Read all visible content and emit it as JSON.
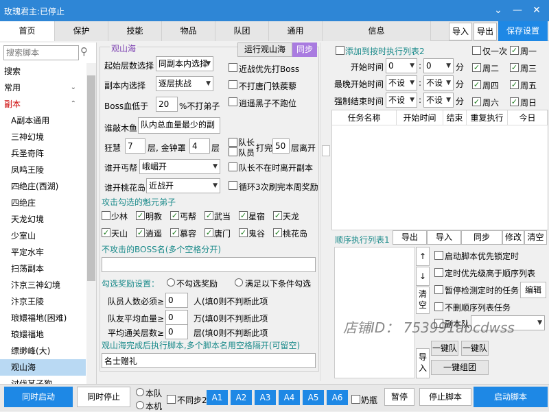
{
  "window": {
    "title": "玫瑰君主:已停止",
    "menu_icon": "chevron-down-icon",
    "min_icon": "minimize-icon",
    "close_icon": "close-icon"
  },
  "tabs": [
    "首页",
    "保护",
    "技能",
    "物品",
    "队团",
    "通用",
    "信息"
  ],
  "top_buttons": {
    "import": "导入",
    "export": "导出",
    "save": "保存设置"
  },
  "sidebar": {
    "search_placeholder": "搜索脚本",
    "items": [
      {
        "label": "搜索",
        "type": "cat"
      },
      {
        "label": "常用",
        "type": "cat",
        "chev": "⌄"
      },
      {
        "label": "副本",
        "type": "cat",
        "chev": "⌃",
        "red": true
      },
      {
        "label": "A副本通用"
      },
      {
        "label": "三神幻境"
      },
      {
        "label": "兵圣奇阵"
      },
      {
        "label": "凤鸣王陵"
      },
      {
        "label": "四绝庄(西湖)"
      },
      {
        "label": "四绝庄"
      },
      {
        "label": "天龙幻境"
      },
      {
        "label": "少室山"
      },
      {
        "label": "平定水牢"
      },
      {
        "label": "扫荡副本"
      },
      {
        "label": "汴京三神幻境"
      },
      {
        "label": "汴京王陵"
      },
      {
        "label": "琅嬛福地(困难)"
      },
      {
        "label": "琅嬛福地"
      },
      {
        "label": "缥缈峰(大)"
      },
      {
        "label": "观山海",
        "selected": true
      },
      {
        "label": "讨伐某子狗"
      }
    ]
  },
  "group": {
    "legend": "观山海",
    "run_button": "运行观山海",
    "sync_button": "同步"
  },
  "form": {
    "start_layer_label": "起始层数选择",
    "start_layer_value": "同副本内选择",
    "in_dungeon_label": "副本内选择",
    "in_dungeon_value": "逐层挑战",
    "boss_hp_label": "Boss血低于",
    "boss_hp_value": "20",
    "boss_hp_suffix": "%不打弟子",
    "who_fish_label": "谁敲木鱼",
    "who_fish_value": "队内总血量最少的副",
    "rage_label": "狂慧",
    "rage_value": "7",
    "rage_mid": "层, 金钟罩",
    "bell_value": "4",
    "bell_suffix": "层",
    "who_beggar_label": "谁开丐帮",
    "who_beggar_value": "峨嵋开",
    "who_peach_label": "谁开桃花岛",
    "who_peach_value": "近战开",
    "cb_melee": "近战优先打Boss",
    "cb_tangmen": "不打唐门铁蒺藜",
    "cb_escape": "逍遥黑子不跑位",
    "cb_leader": "队长",
    "cb_member": "队员",
    "fight_label": "打完",
    "fight_value": "50",
    "fight_suffix": "层离开",
    "cb_leader_leave": "队长不在时离开副本",
    "cb_loop": "循环3次刷完本周奖励",
    "attack_title": "攻击勾选的魁元弟子",
    "sects": [
      {
        "name": "少林",
        "on": false
      },
      {
        "name": "明教",
        "on": true
      },
      {
        "name": "丐帮",
        "on": true
      },
      {
        "name": "武当",
        "on": true
      },
      {
        "name": "星宿",
        "on": true
      },
      {
        "name": "天龙",
        "on": true
      },
      {
        "name": "天山",
        "on": true
      },
      {
        "name": "逍遥",
        "on": true
      },
      {
        "name": "慕容",
        "on": true
      },
      {
        "name": "唐门",
        "on": true
      },
      {
        "name": "鬼谷",
        "on": true
      },
      {
        "name": "桃花岛",
        "on": true
      }
    ],
    "no_boss_title": "不攻击的BOSS名(多个空格分开)",
    "reward_label": "勾选奖励设置：",
    "rb_none": "不勾选奖励",
    "rb_cond": "满足以下条件勾选",
    "member_label": "队员人数必须≥",
    "member_value": "0",
    "member_hint": "人(填0则不判断此项",
    "hp_label": "队友平均血量≥",
    "hp_value": "0",
    "hp_hint": "万(填0则不判断此项",
    "pass_label": "平均通关层数≥",
    "pass_value": "0",
    "pass_hint": "层(填0则不判断此项",
    "after_title": "观山海完成后执行脚本,多个脚本名用空格隔开(可留空)",
    "after_value": "名士赠礼"
  },
  "schedule": {
    "cb_add": "添加到按时执行列表2",
    "cb_once": "仅一次",
    "start_label": "开始时间",
    "start_h": "0",
    "start_m": "0",
    "latest_label": "最晚开始时间",
    "latest_h": "不设",
    "latest_m": "不设",
    "end_label": "强制结束时间",
    "end_h": "不设",
    "end_m": "不设",
    "unit": "分",
    "days": [
      {
        "name": "周一",
        "on": true
      },
      {
        "name": "周二",
        "on": true
      },
      {
        "name": "周三",
        "on": true
      },
      {
        "name": "周四",
        "on": true
      },
      {
        "name": "周五",
        "on": true
      },
      {
        "name": "周六",
        "on": true
      },
      {
        "name": "周日",
        "on": true
      }
    ],
    "columns": [
      "任务名称",
      "开始时间",
      "结束",
      "重复执行",
      "今日"
    ]
  },
  "seq": {
    "title": "顺序执行列表1",
    "export": "导出",
    "import": "导入",
    "sync": "同步",
    "modify": "修改",
    "clear": "清空",
    "up": "↑",
    "down": "↓",
    "clear2": "清空",
    "import2": "导入",
    "cb_lock": "启动脚本优先锁定时",
    "cb_timed": "定时优先级高于顺序列表",
    "cb_pause": "暂停检测定时的任务",
    "edit": "编辑",
    "cb_nodel": "不删顺序列表任务",
    "cb_team": "副本队",
    "team_value": "",
    "one_team": "一键队",
    "one_team2": "一键队",
    "one_group": "一键组团"
  },
  "bottom": {
    "start_all": "同时启动",
    "stop_all": "同时停止",
    "rb_team": "本队",
    "rb_local": "本机",
    "cb_nosync": "不同步2",
    "accounts": [
      "A1",
      "A2",
      "A3",
      "A4",
      "A5",
      "A6"
    ],
    "cb_bottle": "奶瓶",
    "pause": "暂停",
    "stop_script": "停止脚本",
    "start_script": "启动脚本"
  },
  "watermark": "店铺ID： 753991abcdwss",
  "colors": {
    "accent": "#1e88e5",
    "title": "#2e86d6",
    "teal": "#1a8a8a",
    "group_legend": "#7b3fb0"
  }
}
